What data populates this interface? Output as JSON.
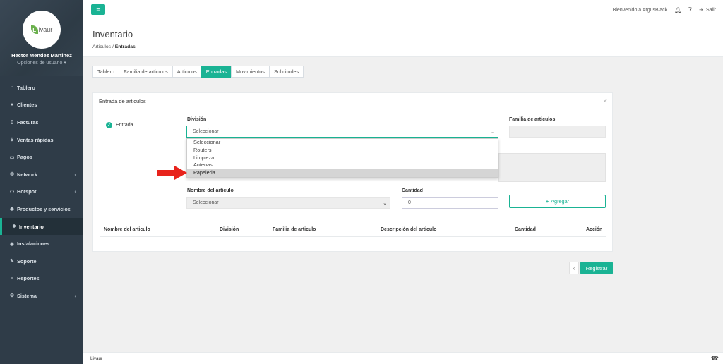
{
  "sidebar": {
    "logo_text": "ivaur",
    "logo_letter": "L",
    "user_name": "Hector Mendez Martinez",
    "user_options": "Opciones de usuario",
    "items": [
      {
        "label": "Tablero",
        "icon": "dashboard-icon",
        "chevron": false
      },
      {
        "label": "Clientes",
        "icon": "users-icon",
        "chevron": false
      },
      {
        "label": "Facturas",
        "icon": "file-icon",
        "chevron": false
      },
      {
        "label": "Ventas rápidas",
        "icon": "dollar-icon",
        "chevron": false
      },
      {
        "label": "Pagos",
        "icon": "money-icon",
        "chevron": false
      },
      {
        "label": "Network",
        "icon": "network-icon",
        "chevron": true
      },
      {
        "label": "Hotspot",
        "icon": "wifi-icon",
        "chevron": true
      },
      {
        "label": "Productos y servicios",
        "icon": "tag-icon",
        "chevron": false
      },
      {
        "label": "Inventario",
        "icon": "cubes-icon",
        "chevron": false,
        "active": true
      },
      {
        "label": "Instalaciones",
        "icon": "tag-icon",
        "chevron": false
      },
      {
        "label": "Soporte",
        "icon": "wrench-icon",
        "chevron": false
      },
      {
        "label": "Reportes",
        "icon": "database-icon",
        "chevron": false
      },
      {
        "label": "Sistema",
        "icon": "gears-icon",
        "chevron": true
      }
    ]
  },
  "topbar": {
    "welcome": "Bienvenido a ArgusBlack",
    "logout": "Salir"
  },
  "heading": {
    "title": "Inventario",
    "crumb_parent": "Articulos",
    "crumb_current": "Entradas"
  },
  "tabs": [
    {
      "label": "Tablero"
    },
    {
      "label": "Familia de articulos"
    },
    {
      "label": "Articulos"
    },
    {
      "label": "Entradas",
      "active": true
    },
    {
      "label": "Movimientos"
    },
    {
      "label": "Solicitudes"
    }
  ],
  "panel": {
    "title": "Entrada de articulos",
    "close": "×",
    "radio_label": "Entrada",
    "division_label": "División",
    "division_value": "Seleccionar",
    "familia_label": "Familia de articulos",
    "nombre_label": "Nombre del articulo",
    "nombre_value": "Seleccionar",
    "cantidad_label": "Cantidad",
    "cantidad_value": "0",
    "agregar": "Agregar",
    "dropdown_options": [
      "Seleccionar",
      "Routers",
      "Limpieza",
      "Antenas",
      "Papeleria"
    ],
    "dropdown_highlighted": 4,
    "table_headers": [
      "Nombre del articulo",
      "División",
      "Familia de articulo",
      "Descripción del articulo",
      "Cantidad",
      "Acción"
    ]
  },
  "actions": {
    "registrar": "Registrar",
    "back": "‹"
  },
  "footer": {
    "text": "Livaur"
  },
  "colors": {
    "accent": "#1ab394",
    "sidebar": "#2f3c48",
    "arrow": "#e8231c"
  }
}
